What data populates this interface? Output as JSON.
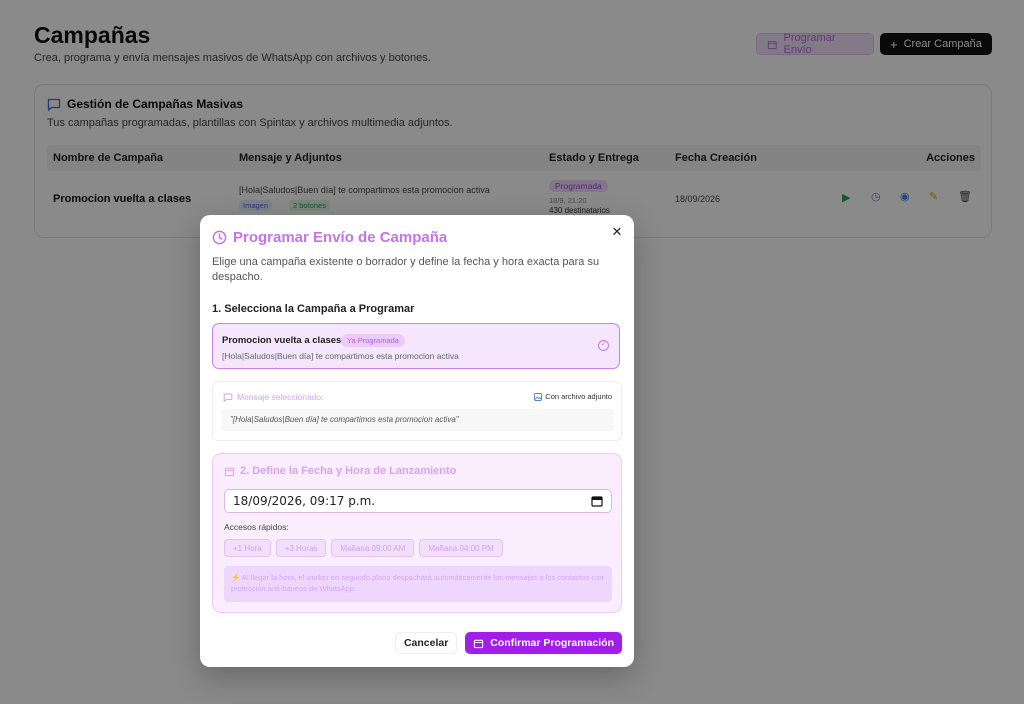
{
  "header": {
    "title": "Campañas",
    "subtitle": "Crea, programa y envía mensajes masivos de WhatsApp con archivos y botones.",
    "schedule_button": "Programar Envío",
    "create_button": "Crear Campaña"
  },
  "card": {
    "title": "Gestión de Campañas Masivas",
    "subtitle": "Tus campañas programadas, plantillas con Spintax y archivos multimedia adjuntos.",
    "columns": [
      "Nombre de Campaña",
      "Mensaje y Adjuntos",
      "Estado y Entrega",
      "Fecha Creación",
      "Acciones"
    ],
    "rows": [
      {
        "name": "Promocion vuelta a clases",
        "message": "[Hola|Saludos|Buen día] te compartimos esta promocion activa",
        "attachment_tag": "Imagen",
        "buttons_tag": "2 botones",
        "status": "Programada",
        "status_date": "18/9, 21:20",
        "recipients": "430 destinatarios",
        "created": "18/09/2026"
      }
    ]
  },
  "modal": {
    "title": "Programar Envío de Campaña",
    "description": "Elige una campaña existente o borrador y define la fecha y hora exacta para su despacho.",
    "step1": "1. Selecciona la Campaña a Programar",
    "campaign_option": {
      "name": "Promocion vuelta a clases",
      "badge": "Ya Programada",
      "message": "[Hola|Saludos|Buen día] te compartimos esta promocion activa"
    },
    "selected_message": {
      "label": "Mensaje seleccionado:",
      "attachment": "Con archivo adjunto",
      "text": "\"[Hola|Saludos|Buen día] te compartimos esta promocion activa\""
    },
    "step2": "2. Define la Fecha y Hora de Lanzamiento",
    "datetime_value": "18/09/2026, 09:17 p.m.",
    "quick_label": "Accesos rápidos:",
    "quick_options": [
      "+1 Hora",
      "+3 Horas",
      "Mañana 09:00 AM",
      "Mañana 04:00 PM"
    ],
    "note": "⚡ Al llegar la hora, el worker en segundo plano despachará automáticamente los mensajes a los contactos con protección anti-baneos de WhatsApp.",
    "cancel": "Cancelar",
    "confirm": "Confirmar Programación"
  },
  "colors": {
    "accent": "#a21de7",
    "accent_light": "#c574e8",
    "overlay": "#000000"
  }
}
